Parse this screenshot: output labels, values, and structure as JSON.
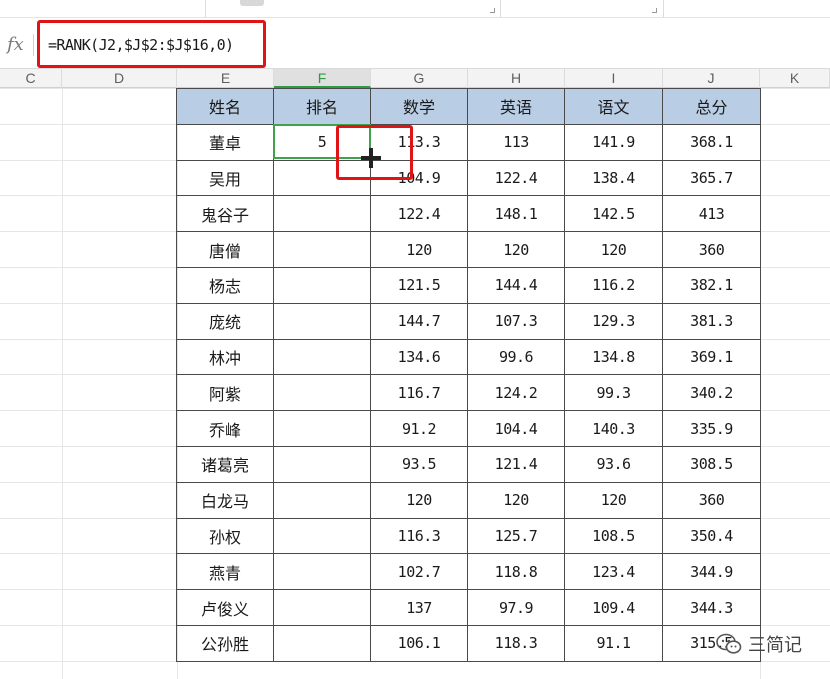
{
  "formula_bar": {
    "fx_label": "fx",
    "formula": "=RANK(J2,$J$2:$J$16,0)"
  },
  "columns": [
    "C",
    "D",
    "E",
    "F",
    "G",
    "H",
    "I",
    "J",
    "K"
  ],
  "selected_column": "F",
  "table": {
    "headers": [
      "姓名",
      "排名",
      "数学",
      "英语",
      "语文",
      "总分"
    ],
    "rows": [
      [
        "董卓",
        "5",
        "113.3",
        "113",
        "141.9",
        "368.1"
      ],
      [
        "吴用",
        "",
        "104.9",
        "122.4",
        "138.4",
        "365.7"
      ],
      [
        "鬼谷子",
        "",
        "122.4",
        "148.1",
        "142.5",
        "413"
      ],
      [
        "唐僧",
        "",
        "120",
        "120",
        "120",
        "360"
      ],
      [
        "杨志",
        "",
        "121.5",
        "144.4",
        "116.2",
        "382.1"
      ],
      [
        "庞统",
        "",
        "144.7",
        "107.3",
        "129.3",
        "381.3"
      ],
      [
        "林冲",
        "",
        "134.6",
        "99.6",
        "134.8",
        "369.1"
      ],
      [
        "阿紫",
        "",
        "116.7",
        "124.2",
        "99.3",
        "340.2"
      ],
      [
        "乔峰",
        "",
        "91.2",
        "104.4",
        "140.3",
        "335.9"
      ],
      [
        "诸葛亮",
        "",
        "93.5",
        "121.4",
        "93.6",
        "308.5"
      ],
      [
        "白龙马",
        "",
        "120",
        "120",
        "120",
        "360"
      ],
      [
        "孙权",
        "",
        "116.3",
        "125.7",
        "108.5",
        "350.4"
      ],
      [
        "燕青",
        "",
        "102.7",
        "118.8",
        "123.4",
        "344.9"
      ],
      [
        "卢俊义",
        "",
        "137",
        "97.9",
        "109.4",
        "344.3"
      ],
      [
        "公孙胜",
        "",
        "106.1",
        "118.3",
        "91.1",
        "315.5"
      ]
    ]
  },
  "watermark": {
    "text": "三简记",
    "icon": "wechat-icon"
  },
  "colors": {
    "header_fill": "#b9cde4",
    "selection_green": "#3fa34d",
    "highlight_red": "#e01414"
  }
}
